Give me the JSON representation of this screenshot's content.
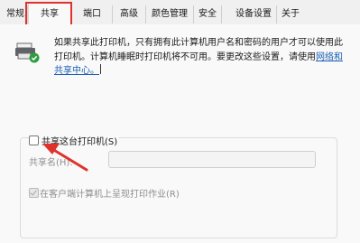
{
  "tabs": [
    {
      "label": "常规",
      "selected": false
    },
    {
      "label": "共享",
      "selected": true
    },
    {
      "label": "端口",
      "selected": false
    },
    {
      "label": "高级",
      "selected": false
    },
    {
      "label": "颜色管理",
      "selected": false
    },
    {
      "label": "安全",
      "selected": false
    },
    {
      "label": "设备设置",
      "selected": false
    },
    {
      "label": "关于",
      "selected": false
    }
  ],
  "icons": {
    "printer": "printer-with-check-icon",
    "arrow": "red-arrow-annotation"
  },
  "colors": {
    "highlight": "#e0322c",
    "link": "#1a5fb4"
  },
  "description": {
    "text": "如果共享此打印机，只有拥有此计算机用户名和密码的用户才可以使用此打印机。计算机睡眠时打印机将不可用。要更改这些设置，请使用",
    "link": "网络和共享中心。"
  },
  "share_printer": {
    "label": "共享这台打印机(S)",
    "checked": false
  },
  "share_name": {
    "label": "共享名(H):",
    "value": ""
  },
  "render_jobs": {
    "label": "在客户端计算机上呈现打印作业(R)",
    "checked": true,
    "enabled": false
  }
}
